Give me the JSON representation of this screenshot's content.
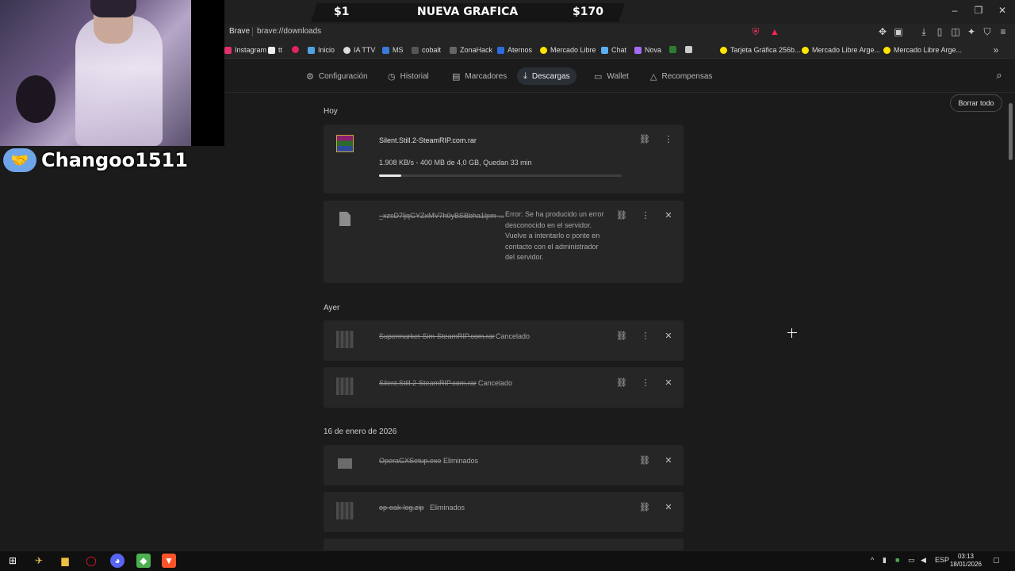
{
  "overlay": {
    "banner_left": "$1",
    "banner_center": "NUEVA GRAFICA",
    "banner_right": "$170",
    "streamer_name": "Changoo1511"
  },
  "browser": {
    "brand": "Brave",
    "url": "brave://downloads",
    "window_controls": [
      "–",
      "❐",
      "✕"
    ]
  },
  "bookmarks": [
    {
      "label": "Instagram",
      "color": "#e1306c"
    },
    {
      "label": "tt",
      "color": "#111111"
    },
    {
      "label": "",
      "color": "#e0245e"
    },
    {
      "label": "Inicio",
      "color": "#4fa3e0"
    },
    {
      "label": "IA TTV",
      "color": "#dddddd"
    },
    {
      "label": "MS",
      "color": "#3a7bd5"
    },
    {
      "label": "cobalt",
      "color": "#222222"
    },
    {
      "label": "ZonaHack",
      "color": "#444444"
    },
    {
      "label": "Aternos",
      "color": "#2d6cdf"
    },
    {
      "label": "Mercado Libre",
      "color": "#ffe600"
    },
    {
      "label": "Chat",
      "color": "#5ab0f0"
    },
    {
      "label": "Nova",
      "color": "#a46cf5"
    },
    {
      "label": "",
      "color": "#2e7d32"
    },
    {
      "label": "",
      "color": "#333333"
    },
    {
      "label": "Tarjeta Gráfica 256b...",
      "color": "#ffe600"
    },
    {
      "label": "Mercado Libre Arge...",
      "color": "#ffe600"
    },
    {
      "label": "Mercado Libre Arge...",
      "color": "#ffe600"
    }
  ],
  "nav": {
    "tabs": [
      {
        "label": "Configuración",
        "icon": "gear-icon"
      },
      {
        "label": "Historial",
        "icon": "history-icon"
      },
      {
        "label": "Marcadores",
        "icon": "bookmark-icon"
      },
      {
        "label": "Descargas",
        "icon": "download-icon",
        "active": true
      },
      {
        "label": "Wallet",
        "icon": "wallet-icon"
      },
      {
        "label": "Recompensas",
        "icon": "rewards-icon"
      }
    ],
    "clear_all": "Borrar todo"
  },
  "sections": {
    "today": "Hoy",
    "yesterday": "Ayer",
    "jan16": "16 de enero de 2026"
  },
  "downloads": {
    "active": {
      "name": "Silent.Still.2-SteamRIP.com.rar",
      "progress_text": "1.908 KB/s - 400 MB de 4,0 GB, Quedan 33 min",
      "progress": 0.09
    },
    "failed": {
      "name": "_xzcD7ljqGYZxMV7h0yBSBbha1lpm-...",
      "error": "Error: Se ha producido un error desconocido en el servidor. Vuelve a intentarlo o ponte en contacto con el administrador del servidor."
    },
    "yesterday": [
      {
        "name": "Supermarket-Sim-SteamRIP.com.rar",
        "status": "Cancelado"
      },
      {
        "name": "Silent.Still.2-SteamRIP.com.rar",
        "status": "Cancelado"
      }
    ],
    "jan16": [
      {
        "name": "OperaGXSetup.exe",
        "status": "Eliminados"
      },
      {
        "name": "op-oak-log.zip",
        "status": "Eliminados"
      }
    ]
  },
  "taskbar": {
    "language": "ESP",
    "time": "03:13",
    "date": "18/01/2026"
  }
}
